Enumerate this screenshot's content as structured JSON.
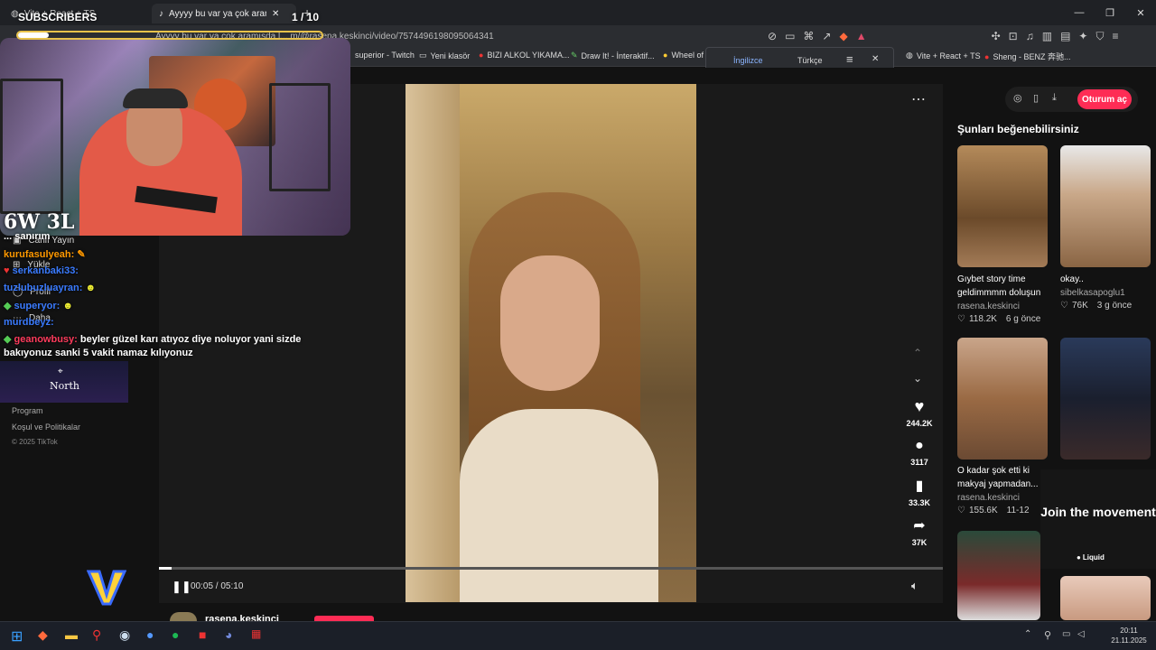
{
  "tabs": [
    {
      "label": "Vite + React + TS",
      "active": false
    },
    {
      "label": "Ayyyy bu var ya çok aramışd...",
      "active": true
    }
  ],
  "address": {
    "url": "Ayyyy bu var ya çok aramışda l...   m/@rasena.keskinci/video/7574496198095064341"
  },
  "bookmarks": [
    "superior - Twitch",
    "Yeni klasör",
    "BIZI ALKOL YIKAMA...",
    "Draw It! - İnteraktif...",
    "Wheel of",
    "Vite + React + TS",
    "Sheng - BENZ 奔驰..."
  ],
  "translate": {
    "from": "İngilizce",
    "to": "Türkçe"
  },
  "overlay": {
    "subs_label": "SUBSCRIBERS",
    "subs_count": "1 / 10",
    "wl": "6W 3L",
    "north": "North",
    "chat": [
      {
        "user": "...",
        "msg": "... sanırım",
        "color": "#ffffff"
      },
      {
        "user": "kurufasulyeah:",
        "msg": "",
        "color": "#ff9900"
      },
      {
        "user": "serkanbaki33:",
        "msg": "",
        "color": "#3a7bff"
      },
      {
        "user": "tuzlubuzluayran:",
        "msg": "",
        "color": "#3a7bff"
      },
      {
        "user": "superyor:",
        "msg": "",
        "color": "#3a7bff"
      },
      {
        "user": "murdbeyz:",
        "msg": "",
        "color": "#3a7bff"
      },
      {
        "user": "geanowbusy:",
        "msg": "beyler güzel karı atıyoz diye noluyor yani sizde bakıyonuz sanki 5 vakit namaz kılıyonuz",
        "color": "#ff3b5c"
      }
    ]
  },
  "leftnav": {
    "items": [
      "Canlı Yayın",
      "Yükle",
      "Profil",
      "Daha"
    ],
    "footer": [
      "Program",
      "Koşul ve Politikalar",
      "© 2025 TikTok"
    ]
  },
  "player": {
    "time": "00:05 / 05:10",
    "progress": 0.016,
    "likes": "244.2K",
    "comments": "3117",
    "saves": "33.3K",
    "shares": "37K",
    "author": "rasena.keskinci"
  },
  "right": {
    "login": "Oturum aç",
    "heading": "Şunları beğenebilirsiniz",
    "cards": [
      {
        "title": "Gıybet story time geldimmmm doluşun",
        "author": "rasena.keskinci",
        "likes": "118.2K",
        "age": "6 g önce"
      },
      {
        "title": "okay..",
        "author": "sibelkasapoglu1",
        "likes": "76K",
        "age": "3 g önce"
      },
      {
        "title": "O kadar şok etti ki makyaj yapmadan...",
        "author": "rasena.keskinci",
        "likes": "155.6K",
        "age": "11-12"
      }
    ],
    "ad_title": "Join the movement",
    "ad_brand": "Liquid"
  },
  "taskbar": {
    "time": "20:11",
    "date": "21.11.2025"
  },
  "colors": {
    "accent": "#fe2c55",
    "bg": "#121212"
  }
}
